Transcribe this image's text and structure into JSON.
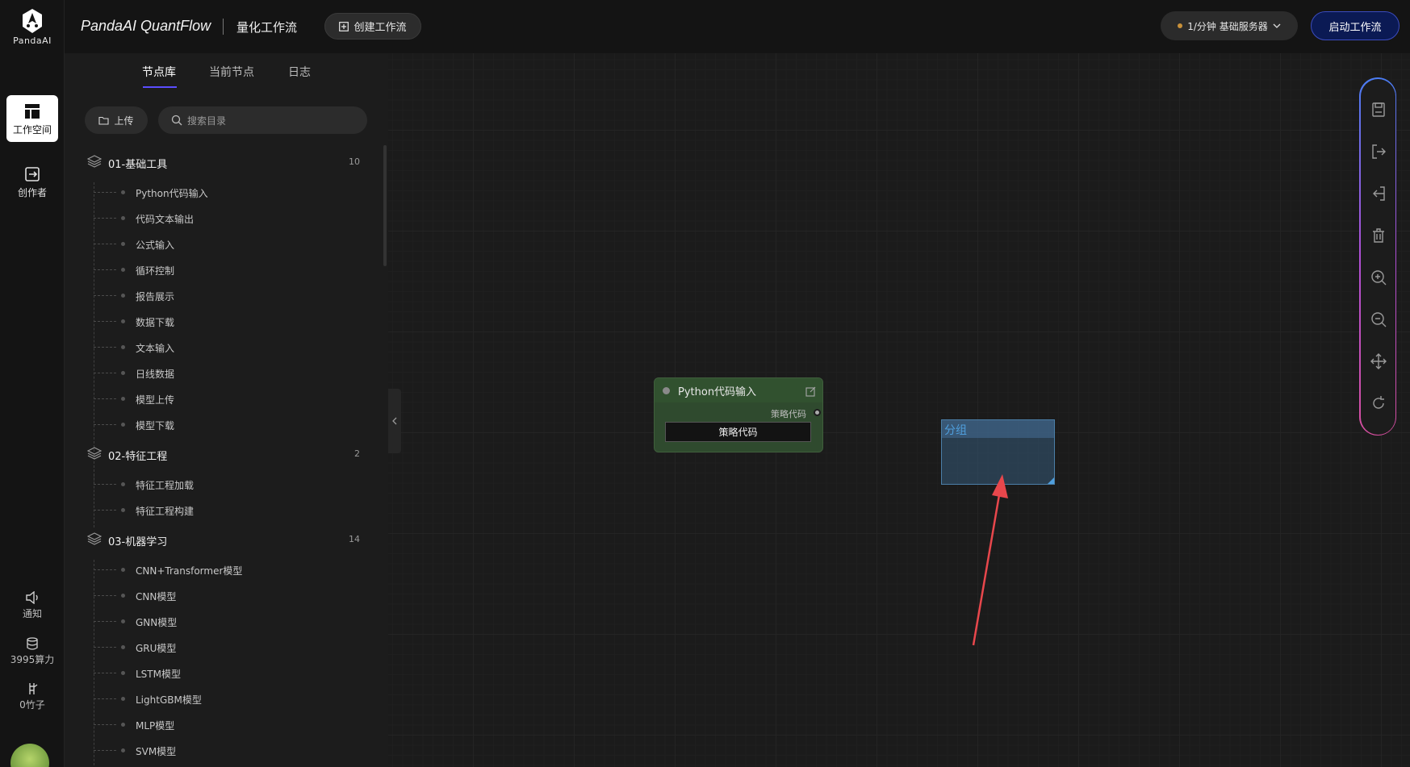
{
  "rail": {
    "logo_text": "PandaAI",
    "workspace_label": "工作空间",
    "creator_label": "创作者",
    "notify_label": "通知",
    "compute_label": "3995算力",
    "bamboo_label": "0竹子"
  },
  "topbar": {
    "brand": "PandaAI QuantFlow",
    "subtitle": "量化工作流",
    "create_label": "创建工作流",
    "server_label": "1/分钟  基础服务器",
    "start_label": "启动工作流"
  },
  "panel": {
    "tabs": [
      "节点库",
      "当前节点",
      "日志"
    ],
    "upload_label": "上传",
    "search_placeholder": "搜索目录",
    "groups": [
      {
        "title": "01-基础工具",
        "count": "10",
        "items": [
          "Python代码输入",
          "代码文本输出",
          "公式输入",
          "循环控制",
          "报告展示",
          "数据下载",
          "文本输入",
          "日线数据",
          "模型上传",
          "模型下载"
        ]
      },
      {
        "title": "02-特征工程",
        "count": "2",
        "items": [
          "特征工程加载",
          "特征工程构建"
        ]
      },
      {
        "title": "03-机器学习",
        "count": "14",
        "items": [
          "CNN+Transformer模型",
          "CNN模型",
          "GNN模型",
          "GRU模型",
          "LSTM模型",
          "LightGBM模型",
          "MLP模型",
          "SVM模型"
        ]
      }
    ]
  },
  "canvas": {
    "node": {
      "title": "Python代码输入",
      "output_label": "策略代码",
      "button_label": "策略代码"
    },
    "group_box": {
      "title": "分组"
    }
  },
  "colors": {
    "accent": "#5b4dff",
    "start_button": "#0b1a54",
    "node_bg": "#2f4a2e",
    "group_bg": "#355a78",
    "arrow": "#e8474c"
  }
}
